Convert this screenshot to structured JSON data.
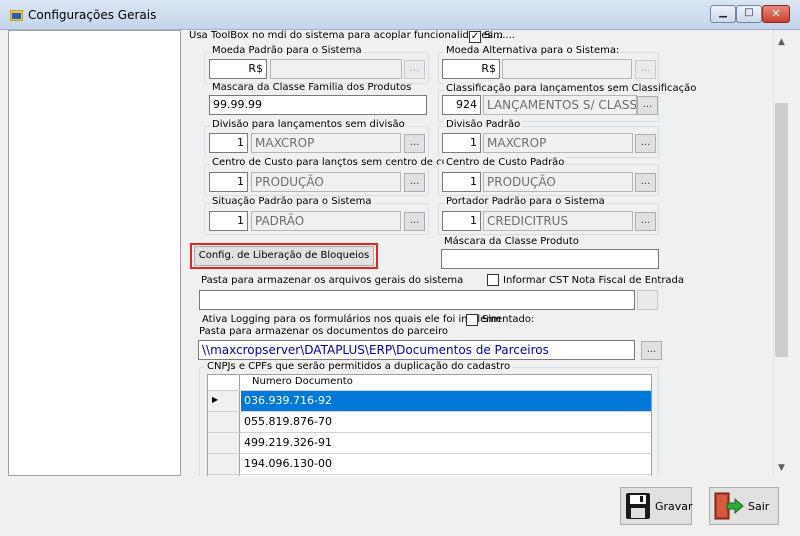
{
  "window": {
    "title": "Configurações Gerais",
    "icons": [
      "app-icon",
      "minimize-icon",
      "maximize-icon",
      "close-icon"
    ]
  },
  "form": {
    "toolbox_label": "Usa ToolBox no mdi do sistema para acoplar funcionalidades.......",
    "toolbox_check_label": "Sim",
    "moeda_padrao": {
      "label": "Moeda Padrão para o Sistema",
      "code": "R$",
      "name": ""
    },
    "moeda_alt": {
      "label": "Moeda Alternativa para o Sistema:",
      "code": "R$",
      "name": ""
    },
    "mascara_familia": {
      "label": "Mascara da Classe Familia dos Produtos",
      "value": "99.99.99"
    },
    "classificacao": {
      "label": "Classificação para lançamentos sem Classificação",
      "code": "924",
      "name": "LANÇAMENTOS S/ CLASSIF"
    },
    "divisao_sem": {
      "label": "Divisão para lançamentos sem divisão",
      "code": "1",
      "name": "MAXCROP"
    },
    "divisao_padrao": {
      "label": "Divisão Padrão",
      "code": "1",
      "name": "MAXCROP"
    },
    "cc_sem": {
      "label": "Centro de Custo para lançtos sem centro de custo",
      "code": "1",
      "name": "PRODUÇÃO"
    },
    "cc_padrao": {
      "label": "Centro de Custo Padrão",
      "code": "1",
      "name": "PRODUÇÃO"
    },
    "situacao": {
      "label": "Situação Padrão para o Sistema",
      "code": "1",
      "name": "PADRÃO"
    },
    "portador": {
      "label": "Portador Padrão para o Sistema",
      "code": "1",
      "name": "CREDICITRUS"
    },
    "lookup_label": "...",
    "config_bloqueios_label": "Config. de Liberação de Bloqueios",
    "mascara_produto": {
      "label": "Máscara da Classe Produto",
      "value": ""
    },
    "pasta_arquivos": {
      "label": "Pasta para armazenar os arquivos gerais do sistema",
      "value": ""
    },
    "cst_label": "Informar CST Nota Fiscal de Entrada",
    "logging_label": "Ativa Logging para os formulários nos quais ele foi implementado:",
    "logging_check_label": "Sim",
    "pasta_parceiro": {
      "label": "Pasta para armazenar os documentos do parceiro",
      "value": "\\\\maxcropserver\\DATAPLUS\\ERP\\Documentos de Parceiros"
    },
    "cnpj_group_label": "CNPJs e CPFs que serão permitidos a duplicação do cadastro",
    "grid": {
      "header": "Numero Documento",
      "rows": [
        "036.939.716-92",
        "055.819.876-70",
        "499.219.326-91",
        "194.096.130-00"
      ],
      "current_marker": "▶",
      "new_marker": "✱"
    }
  },
  "buttons": {
    "gravar": "Gravar",
    "sair": "Sair"
  }
}
